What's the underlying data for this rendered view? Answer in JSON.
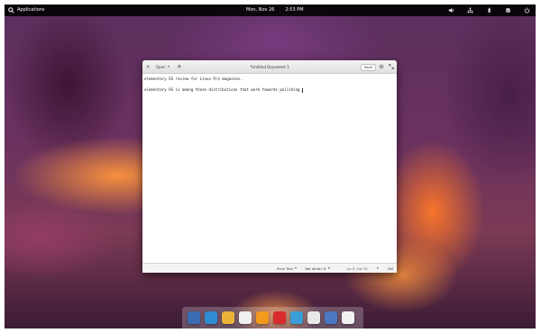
{
  "panel": {
    "applications_label": "Applications",
    "date": "Mon, Nov 26",
    "time": "2:53 PM",
    "indicators": [
      "volume-icon",
      "network-icon",
      "bluetooth-icon",
      "notifications-icon",
      "power-icon"
    ]
  },
  "window": {
    "title": "*Untitled Document 1",
    "open_label": "Open",
    "save_label": "Save",
    "icons": [
      "close-icon",
      "chevron-down-icon",
      "plus-icon",
      "gear-icon",
      "fullscreen-icon"
    ]
  },
  "editor": {
    "lines": [
      "elementary OS review for Linux Pro magazine.",
      "",
      "elementary OS is among those distributions that work towards polishing"
    ]
  },
  "statusbar": {
    "language": "Plain Text",
    "tab_width": "Tab Width: 8",
    "position": "Ln 3, Col 72",
    "mode": "INS"
  },
  "dock": {
    "apps": [
      {
        "name": "multitasking-view-icon",
        "color": "#3b6db5"
      },
      {
        "name": "web-browser-icon",
        "color": "#2f8dd4"
      },
      {
        "name": "mail-icon",
        "color": "#e9b33a"
      },
      {
        "name": "calendar-icon",
        "color": "#efefef"
      },
      {
        "name": "music-icon",
        "color": "#f39a1c"
      },
      {
        "name": "videos-icon",
        "color": "#d92b2b"
      },
      {
        "name": "photos-icon",
        "color": "#3a9fd8"
      },
      {
        "name": "terminal-icon",
        "color": "#e8e8e8"
      },
      {
        "name": "system-settings-icon",
        "color": "#4a78c2"
      },
      {
        "name": "text-editor-icon",
        "color": "#f2f2f2"
      }
    ]
  }
}
